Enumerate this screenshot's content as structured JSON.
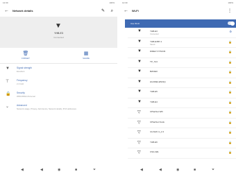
{
  "left": {
    "status_left": "12:30",
    "status_right": "100%",
    "title": "Network details",
    "network_name": "YHB-E3",
    "network_status": "Connected",
    "actions": [
      {
        "label": "FORGET",
        "icon": "trash-icon"
      },
      {
        "label": "SHARE",
        "icon": "qr-code-icon"
      }
    ],
    "info": [
      {
        "title": "Signal strength",
        "sub": "Excellent",
        "icon": "wifi-icon"
      },
      {
        "title": "Frequency",
        "sub": "2.4 GHz",
        "icon": "frequency-icon"
      },
      {
        "title": "Security",
        "sub": "WPA/WPA2-Personal",
        "icon": "lock-icon"
      },
      {
        "title": "Advanced",
        "sub": "Network usage, Privacy, Add device, Network details, IPv6 addresses",
        "icon": "chevron-down-icon"
      }
    ]
  },
  "right": {
    "status_left": "12:30",
    "status_right": "100%",
    "title": "Wi-Fi",
    "toggle_label": "Use Wi-Fi",
    "networks": [
      {
        "name": "YHB-E3",
        "sub": "Connected"
      },
      {
        "name": "YHB-E3B7-1",
        "sub": "Saved"
      },
      {
        "name": "DIRECT-TPLINK",
        "sub": ""
      },
      {
        "name": "TP_7A4",
        "sub": ""
      },
      {
        "name": "B2F2E0",
        "sub": ""
      },
      {
        "name": "HUAWEI-E5A3Q",
        "sub": ""
      },
      {
        "name": "YHB-E5",
        "sub": ""
      },
      {
        "name": "YHB-E4",
        "sub": ""
      },
      {
        "name": "CPlanNet Wifi",
        "sub": ""
      },
      {
        "name": "CPlanNet Kiosk",
        "sub": ""
      },
      {
        "name": "ricohwifi-m_2.4",
        "sub": ""
      },
      {
        "name": "YHB-E6",
        "sub": ""
      },
      {
        "name": "CSG-WE",
        "sub": ""
      }
    ]
  },
  "navbar": [
    "◀",
    "◉",
    "■",
    "⏷"
  ]
}
